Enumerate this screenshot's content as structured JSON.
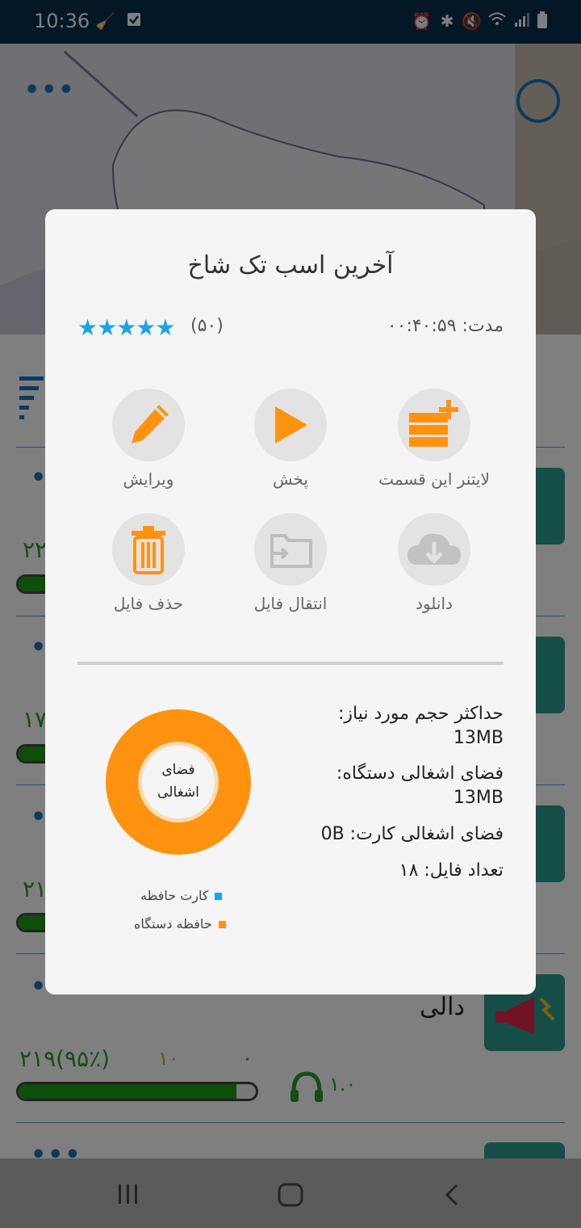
{
  "status_bar": {
    "time": "10:36",
    "left_icons": [
      "brush-icon",
      "checkbox-icon"
    ],
    "right_icons": [
      "alarm-icon",
      "bluetooth-icon",
      "mute-icon",
      "wifi-icon",
      "signal-icon",
      "battery-icon"
    ]
  },
  "background_list": {
    "rows": [
      {
        "count": "۲۲",
        "progress": 0.95
      },
      {
        "count": "۱۷",
        "progress": 0.95
      },
      {
        "count": "۲۱",
        "progress": 0.95
      },
      {
        "title": "دالی",
        "stat_total": "۲۱۹(۹۵٪)",
        "stat_mid": "۱۰",
        "stat_low": "۰",
        "listens": "۱.۰",
        "progress": 0.95
      }
    ]
  },
  "dialog": {
    "title": "آخرین اسب تک شاخ",
    "duration": "مدت: ۰۰:۴۰:۵۹",
    "stars": "★★★★★",
    "rating_count": "(۵۰)",
    "actions": [
      {
        "label": "لایتنر این قسمت",
        "icon": "leitner-add-icon"
      },
      {
        "label": "پخش",
        "icon": "play-icon"
      },
      {
        "label": "ویرایش",
        "icon": "pencil-icon"
      },
      {
        "label": "دانلود",
        "icon": "cloud-download-icon"
      },
      {
        "label": "انتقال فایل",
        "icon": "folder-move-icon"
      },
      {
        "label": "حذف فایل",
        "icon": "trash-icon"
      }
    ],
    "info": {
      "max_size_label": "حداکثر حجم مورد نیاز:",
      "max_size_value": "13MB",
      "device_used_label": "فضای اشغالی دستگاه:",
      "device_used_value": "13MB",
      "card_used": "فضای اشغالی کارت: 0B",
      "file_count": "تعداد فایل: ۱۸"
    },
    "donut_label_1": "فضای",
    "donut_label_2": "اشغالی",
    "legend": [
      {
        "label": "کارت حافظه",
        "color": "#1aa3e8"
      },
      {
        "label": "حافظه دستگاه",
        "color": "#ff9310"
      }
    ],
    "colors": {
      "accent": "#ff9310",
      "star": "#1aa3e8",
      "circle_bg": "#e3e3e3"
    }
  },
  "nav_bar": {
    "icons": [
      "recent-apps-icon",
      "home-icon",
      "back-icon"
    ]
  }
}
